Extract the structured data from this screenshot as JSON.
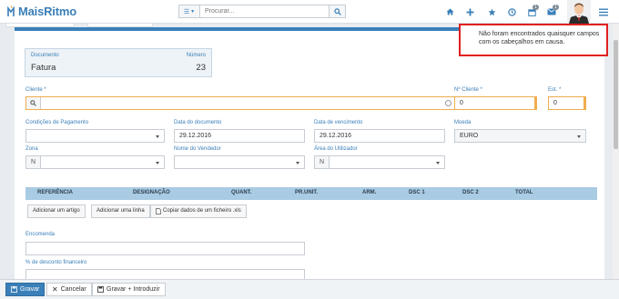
{
  "app": {
    "name": "MaisRitmo"
  },
  "search": {
    "placeholder": "Procurar..."
  },
  "nav": {
    "badges": [
      "1",
      "1"
    ]
  },
  "document": {
    "type_label": "Documento",
    "type_value": "Fatura",
    "number_label": "Número",
    "number_value": "23"
  },
  "form": {
    "cliente_label": "Cliente *",
    "ncliente_label": "Nº Cliente *",
    "ncliente_value": "0",
    "est_label": "Est. *",
    "est_value": "0",
    "cond_label": "Condições de Pagamento",
    "cond_value": "",
    "datadoc_label": "Data do documento",
    "datadoc_value": "29.12.2016",
    "datavenc_label": "Data de vencimento",
    "datavenc_value": "29.12.2016",
    "moeda_label": "Moeda",
    "moeda_value": "EURO",
    "zona_label": "Zona",
    "zona_prefix": "N",
    "vendedor_label": "Nome do Vendedor",
    "area_label": "Área do Utilizador",
    "area_prefix": "N",
    "encomenda_label": "Encomenda",
    "desconto_label": "% de desconto financeiro"
  },
  "table": {
    "columns": [
      "REFERÊNCIA",
      "DESIGNAÇÃO",
      "QUANT.",
      "PR.UNIT.",
      "ARM.",
      "DSC 1",
      "DSC 2",
      "TOTAL"
    ]
  },
  "actions": {
    "add_article": "Adicionar um artigo",
    "add_line": "Adicionar uma linha",
    "copy_file": "Copiar dados de um ficheiro .xls"
  },
  "footer": {
    "save": "Gravar",
    "cancel": "Cancelar",
    "save_insert": "Gravar + Introduzir"
  },
  "toast": {
    "message": "Não foram encontrados quaisquer campos com os cabeçalhos em causa."
  },
  "colors": {
    "accent": "#3a7fb8",
    "table_header": "#a9cbe3",
    "required": "#f0ad4e",
    "toast_border": "#e02020"
  }
}
